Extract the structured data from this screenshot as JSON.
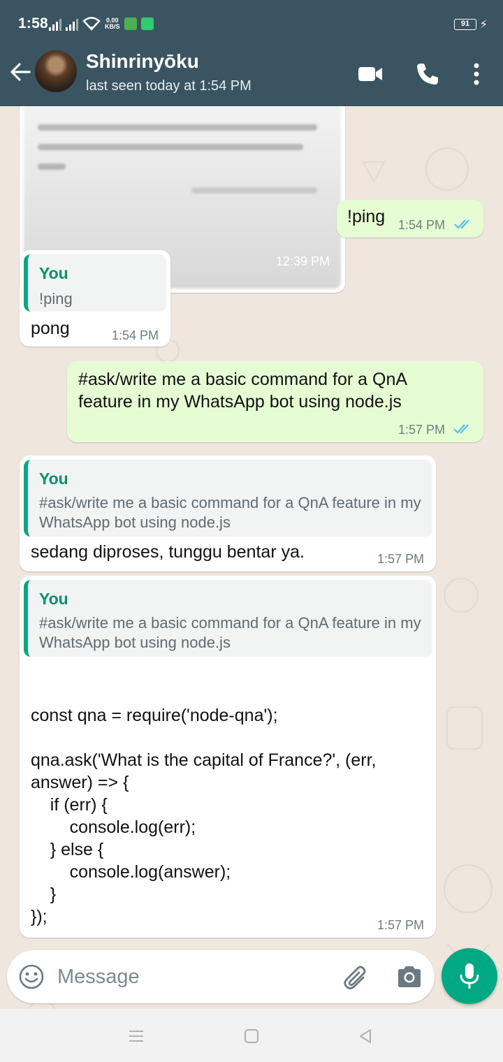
{
  "status_bar": {
    "time": "1:58",
    "net_speed": "0.00",
    "net_unit": "KB/S",
    "battery": "91"
  },
  "header": {
    "contact_name": "Shinrinyōku",
    "contact_status": "last seen today at 1:54 PM"
  },
  "messages": {
    "image_msg": {
      "time": "12:39 PM"
    },
    "ping": {
      "text": "!ping",
      "time": "1:54 PM"
    },
    "pong": {
      "quote_author": "You",
      "quote_text": "!ping",
      "text": "pong",
      "time": "1:54 PM"
    },
    "ask": {
      "text": "#ask/write me a basic command for a QnA feature in my WhatsApp bot using node.js",
      "time": "1:57 PM"
    },
    "processing": {
      "quote_author": "You",
      "quote_text": "#ask/write me a basic command for a QnA feature in my WhatsApp bot using node.js",
      "text": "sedang diproses, tunggu bentar ya.",
      "time": "1:57 PM"
    },
    "answer": {
      "quote_author": "You",
      "quote_text": "#ask/write me a basic command for a QnA feature in my WhatsApp bot using node.js",
      "code": "const qna = require('node-qna');\n\nqna.ask('What is the capital of France?', (err,\nanswer) => {\n    if (err) {\n        console.log(err);\n    } else {\n        console.log(answer);\n    }\n});",
      "time": "1:57 PM"
    }
  },
  "input": {
    "placeholder": "Message"
  },
  "colors": {
    "header": "#3b5461",
    "accent": "#00a884",
    "outgoing_bubble": "#e6fdd4",
    "read_ticks": "#53bdeb"
  },
  "icons": [
    "back-arrow-icon",
    "video-call-icon",
    "voice-call-icon",
    "more-options-icon",
    "double-check-icon",
    "emoji-icon",
    "attach-icon",
    "camera-icon",
    "mic-icon",
    "nav-menu-icon",
    "nav-home-icon",
    "nav-back-icon"
  ]
}
